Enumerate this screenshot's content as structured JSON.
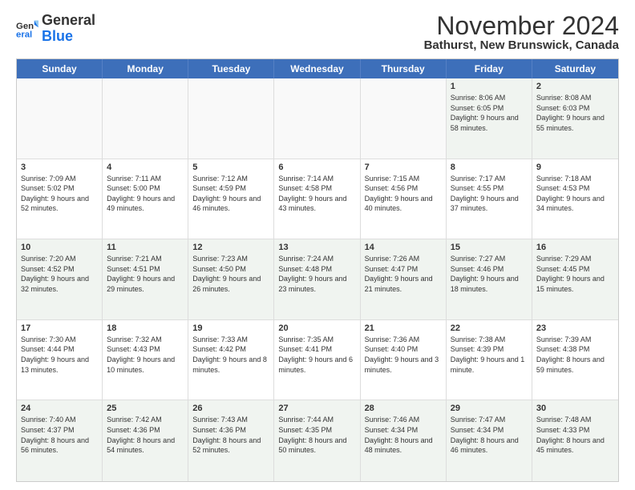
{
  "logo": {
    "general": "General",
    "blue": "Blue"
  },
  "title": "November 2024",
  "location": "Bathurst, New Brunswick, Canada",
  "header": {
    "days": [
      "Sunday",
      "Monday",
      "Tuesday",
      "Wednesday",
      "Thursday",
      "Friday",
      "Saturday"
    ]
  },
  "weeks": [
    [
      {
        "day": "",
        "info": ""
      },
      {
        "day": "",
        "info": ""
      },
      {
        "day": "",
        "info": ""
      },
      {
        "day": "",
        "info": ""
      },
      {
        "day": "",
        "info": ""
      },
      {
        "day": "1",
        "info": "Sunrise: 8:06 AM\nSunset: 6:05 PM\nDaylight: 9 hours and 58 minutes."
      },
      {
        "day": "2",
        "info": "Sunrise: 8:08 AM\nSunset: 6:03 PM\nDaylight: 9 hours and 55 minutes."
      }
    ],
    [
      {
        "day": "3",
        "info": "Sunrise: 7:09 AM\nSunset: 5:02 PM\nDaylight: 9 hours and 52 minutes."
      },
      {
        "day": "4",
        "info": "Sunrise: 7:11 AM\nSunset: 5:00 PM\nDaylight: 9 hours and 49 minutes."
      },
      {
        "day": "5",
        "info": "Sunrise: 7:12 AM\nSunset: 4:59 PM\nDaylight: 9 hours and 46 minutes."
      },
      {
        "day": "6",
        "info": "Sunrise: 7:14 AM\nSunset: 4:58 PM\nDaylight: 9 hours and 43 minutes."
      },
      {
        "day": "7",
        "info": "Sunrise: 7:15 AM\nSunset: 4:56 PM\nDaylight: 9 hours and 40 minutes."
      },
      {
        "day": "8",
        "info": "Sunrise: 7:17 AM\nSunset: 4:55 PM\nDaylight: 9 hours and 37 minutes."
      },
      {
        "day": "9",
        "info": "Sunrise: 7:18 AM\nSunset: 4:53 PM\nDaylight: 9 hours and 34 minutes."
      }
    ],
    [
      {
        "day": "10",
        "info": "Sunrise: 7:20 AM\nSunset: 4:52 PM\nDaylight: 9 hours and 32 minutes."
      },
      {
        "day": "11",
        "info": "Sunrise: 7:21 AM\nSunset: 4:51 PM\nDaylight: 9 hours and 29 minutes."
      },
      {
        "day": "12",
        "info": "Sunrise: 7:23 AM\nSunset: 4:50 PM\nDaylight: 9 hours and 26 minutes."
      },
      {
        "day": "13",
        "info": "Sunrise: 7:24 AM\nSunset: 4:48 PM\nDaylight: 9 hours and 23 minutes."
      },
      {
        "day": "14",
        "info": "Sunrise: 7:26 AM\nSunset: 4:47 PM\nDaylight: 9 hours and 21 minutes."
      },
      {
        "day": "15",
        "info": "Sunrise: 7:27 AM\nSunset: 4:46 PM\nDaylight: 9 hours and 18 minutes."
      },
      {
        "day": "16",
        "info": "Sunrise: 7:29 AM\nSunset: 4:45 PM\nDaylight: 9 hours and 15 minutes."
      }
    ],
    [
      {
        "day": "17",
        "info": "Sunrise: 7:30 AM\nSunset: 4:44 PM\nDaylight: 9 hours and 13 minutes."
      },
      {
        "day": "18",
        "info": "Sunrise: 7:32 AM\nSunset: 4:43 PM\nDaylight: 9 hours and 10 minutes."
      },
      {
        "day": "19",
        "info": "Sunrise: 7:33 AM\nSunset: 4:42 PM\nDaylight: 9 hours and 8 minutes."
      },
      {
        "day": "20",
        "info": "Sunrise: 7:35 AM\nSunset: 4:41 PM\nDaylight: 9 hours and 6 minutes."
      },
      {
        "day": "21",
        "info": "Sunrise: 7:36 AM\nSunset: 4:40 PM\nDaylight: 9 hours and 3 minutes."
      },
      {
        "day": "22",
        "info": "Sunrise: 7:38 AM\nSunset: 4:39 PM\nDaylight: 9 hours and 1 minute."
      },
      {
        "day": "23",
        "info": "Sunrise: 7:39 AM\nSunset: 4:38 PM\nDaylight: 8 hours and 59 minutes."
      }
    ],
    [
      {
        "day": "24",
        "info": "Sunrise: 7:40 AM\nSunset: 4:37 PM\nDaylight: 8 hours and 56 minutes."
      },
      {
        "day": "25",
        "info": "Sunrise: 7:42 AM\nSunset: 4:36 PM\nDaylight: 8 hours and 54 minutes."
      },
      {
        "day": "26",
        "info": "Sunrise: 7:43 AM\nSunset: 4:36 PM\nDaylight: 8 hours and 52 minutes."
      },
      {
        "day": "27",
        "info": "Sunrise: 7:44 AM\nSunset: 4:35 PM\nDaylight: 8 hours and 50 minutes."
      },
      {
        "day": "28",
        "info": "Sunrise: 7:46 AM\nSunset: 4:34 PM\nDaylight: 8 hours and 48 minutes."
      },
      {
        "day": "29",
        "info": "Sunrise: 7:47 AM\nSunset: 4:34 PM\nDaylight: 8 hours and 46 minutes."
      },
      {
        "day": "30",
        "info": "Sunrise: 7:48 AM\nSunset: 4:33 PM\nDaylight: 8 hours and 45 minutes."
      }
    ]
  ]
}
